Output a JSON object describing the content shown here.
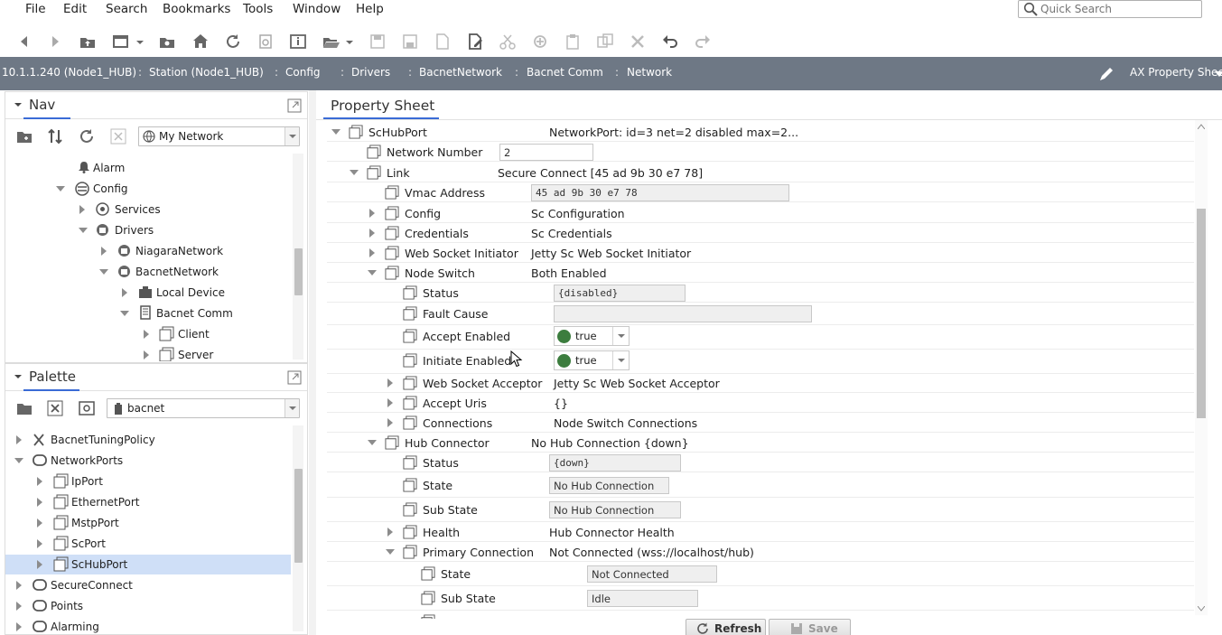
{
  "menu": [
    "File",
    "Edit",
    "Search",
    "Bookmarks",
    "Tools",
    "Window",
    "Help"
  ],
  "quick_search": {
    "placeholder": "Quick Search"
  },
  "toolbar": {
    "buttons": [
      "back-icon",
      "forward-icon",
      "up-level-icon",
      "side-bar-icon",
      "dropdown-icon",
      "open-folder-icon",
      "home-icon",
      "refresh-icon",
      "spy-icon",
      "info-icon",
      "open-icon",
      "save-icon",
      "save-all-icon",
      "export-icon",
      "edit-icon",
      "cut-icon",
      "copy-icon",
      "paste-icon",
      "duplicate-icon",
      "delete-icon",
      "undo-icon",
      "redo-icon"
    ]
  },
  "breadcrumb": {
    "items": [
      "10.1.1.240 (Node1_HUB)",
      "Station (Node1_HUB)",
      "Config",
      "Drivers",
      "BacnetNetwork",
      "Bacnet Comm",
      "Network"
    ],
    "separator": ":",
    "view_selector": "AX Property Sheet"
  },
  "nav": {
    "title": "Nav",
    "dropdown": "My Network",
    "tree": [
      {
        "label": "Alarm"
      },
      {
        "label": "Config"
      },
      {
        "label": "Services"
      },
      {
        "label": "Drivers"
      },
      {
        "label": "NiagaraNetwork"
      },
      {
        "label": "BacnetNetwork"
      },
      {
        "label": "Local Device"
      },
      {
        "label": "Bacnet Comm"
      },
      {
        "label": "Client"
      },
      {
        "label": "Server"
      }
    ]
  },
  "palette": {
    "title": "Palette",
    "dropdown": "bacnet",
    "tree": [
      {
        "label": "BacnetTuningPolicy"
      },
      {
        "label": "NetworkPorts"
      },
      {
        "label": "IpPort"
      },
      {
        "label": "EthernetPort"
      },
      {
        "label": "MstpPort"
      },
      {
        "label": "ScPort"
      },
      {
        "label": "ScHubPort",
        "selected": true
      },
      {
        "label": "SecureConnect"
      },
      {
        "label": "Points"
      },
      {
        "label": "Alarming"
      }
    ]
  },
  "property_sheet": {
    "tab": "Property Sheet",
    "rows": [
      {
        "name": "ScHubPort",
        "value": "NetworkPort: id=3 net=2 disabled max=2..."
      },
      {
        "name": "Network Number",
        "value": "2"
      },
      {
        "name": "Link",
        "value": "Secure Connect [45 ad 9b 30 e7 78]"
      },
      {
        "name": "Vmac Address",
        "value": "45 ad 9b 30 e7 78"
      },
      {
        "name": "Config",
        "value": "Sc Configuration"
      },
      {
        "name": "Credentials",
        "value": "Sc Credentials"
      },
      {
        "name": "Web Socket Initiator",
        "value": "Jetty Sc Web Socket Initiator"
      },
      {
        "name": "Node Switch",
        "value": "Both Enabled"
      },
      {
        "name": "Status",
        "value": "{disabled}"
      },
      {
        "name": "Fault Cause",
        "value": ""
      },
      {
        "name": "Accept Enabled",
        "value": "true"
      },
      {
        "name": "Initiate Enabled",
        "value": "true"
      },
      {
        "name": "Web Socket Acceptor",
        "value": "Jetty Sc Web Socket Acceptor"
      },
      {
        "name": "Accept Uris",
        "value": "{}"
      },
      {
        "name": "Connections",
        "value": "Node Switch Connections"
      },
      {
        "name": "Hub Connector",
        "value": "No Hub Connection {down}"
      },
      {
        "name": "Status",
        "value": "{down}"
      },
      {
        "name": "State",
        "value": "No Hub Connection"
      },
      {
        "name": "Sub State",
        "value": "No Hub Connection"
      },
      {
        "name": "Health",
        "value": "Hub Connector Health"
      },
      {
        "name": "Primary Connection",
        "value": "Not Connected (wss://localhost/hub)"
      },
      {
        "name": "State",
        "value": "Not Connected"
      },
      {
        "name": "Sub State",
        "value": "Idle"
      }
    ],
    "buttons": {
      "refresh": "Refresh",
      "save": "Save"
    }
  },
  "colors": {
    "accent": "#3a6bd6",
    "location_bar": "#6e7885",
    "bool_true": "#3c7d3e",
    "selection": "#cfdff7"
  }
}
